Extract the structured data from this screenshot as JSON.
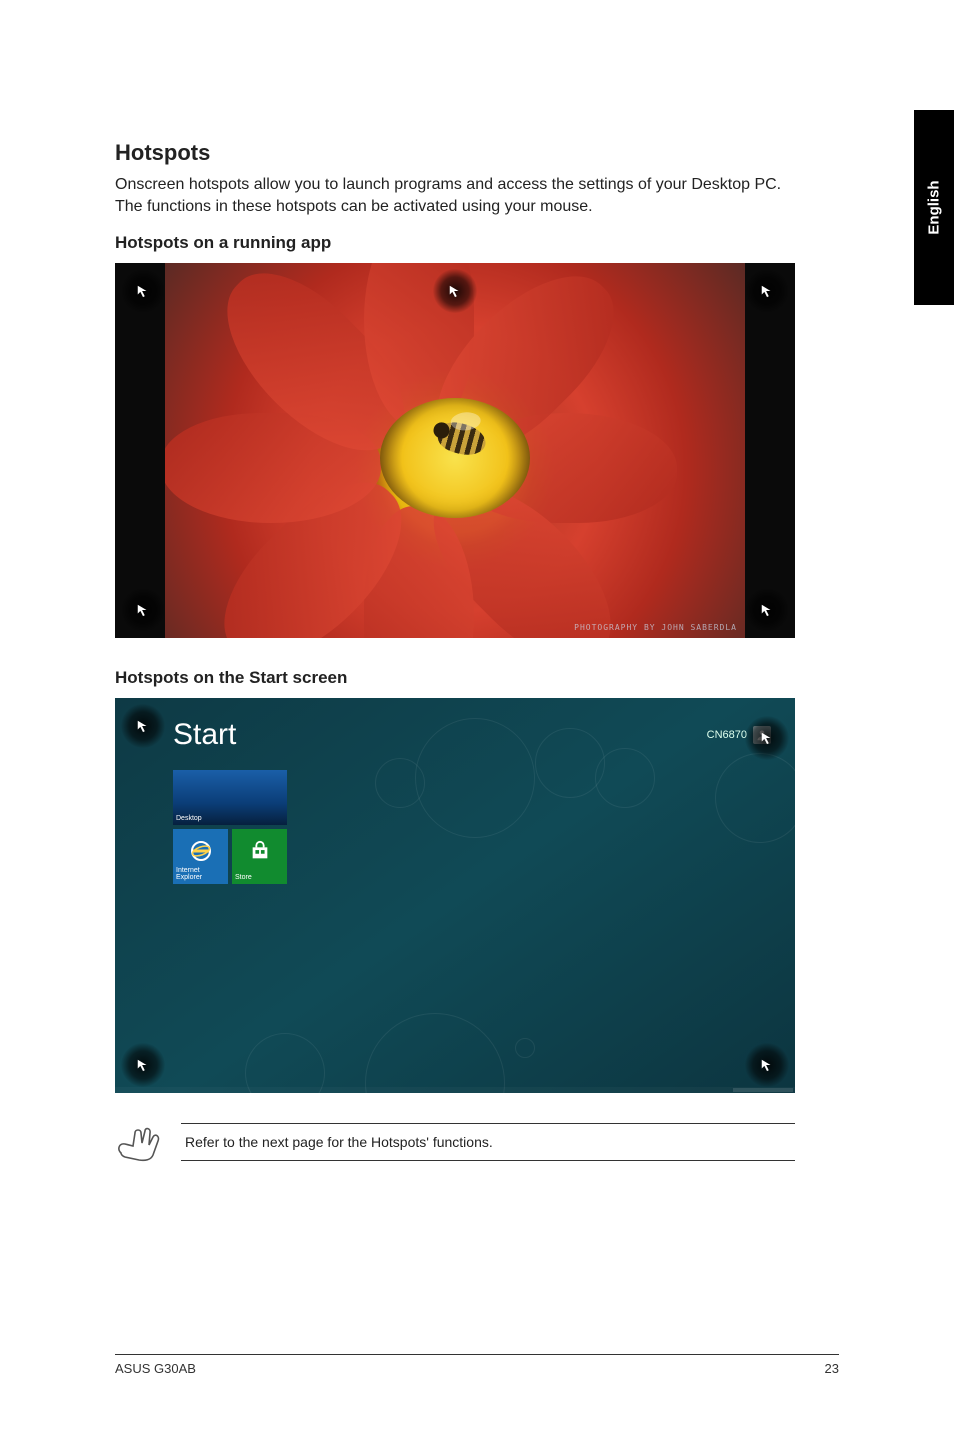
{
  "side_tab": {
    "label": "English"
  },
  "section": {
    "title": "Hotspots",
    "body": "Onscreen hotspots allow you to launch programs and access the settings of your Desktop PC. The functions in these hotspots can be activated using your mouse.",
    "sub1": "Hotspots on a running app",
    "sub2": "Hotspots on the Start screen"
  },
  "running_app": {
    "photo_credit": "PHOTOGRAPHY BY JOHN SABERDLA",
    "hotspots": [
      "top-left",
      "top-center",
      "top-right",
      "bottom-left",
      "bottom-right"
    ]
  },
  "start_screen": {
    "title": "Start",
    "user": "CN6870",
    "tiles": {
      "desktop": "Desktop",
      "ie": "Internet Explorer",
      "store": "Store"
    },
    "hotspots": [
      "top-left",
      "top-right",
      "bottom-left",
      "bottom-right"
    ]
  },
  "note": {
    "text": "Refer to the next page for the Hotspots' functions."
  },
  "footer": {
    "left": "ASUS G30AB",
    "right": "23"
  }
}
